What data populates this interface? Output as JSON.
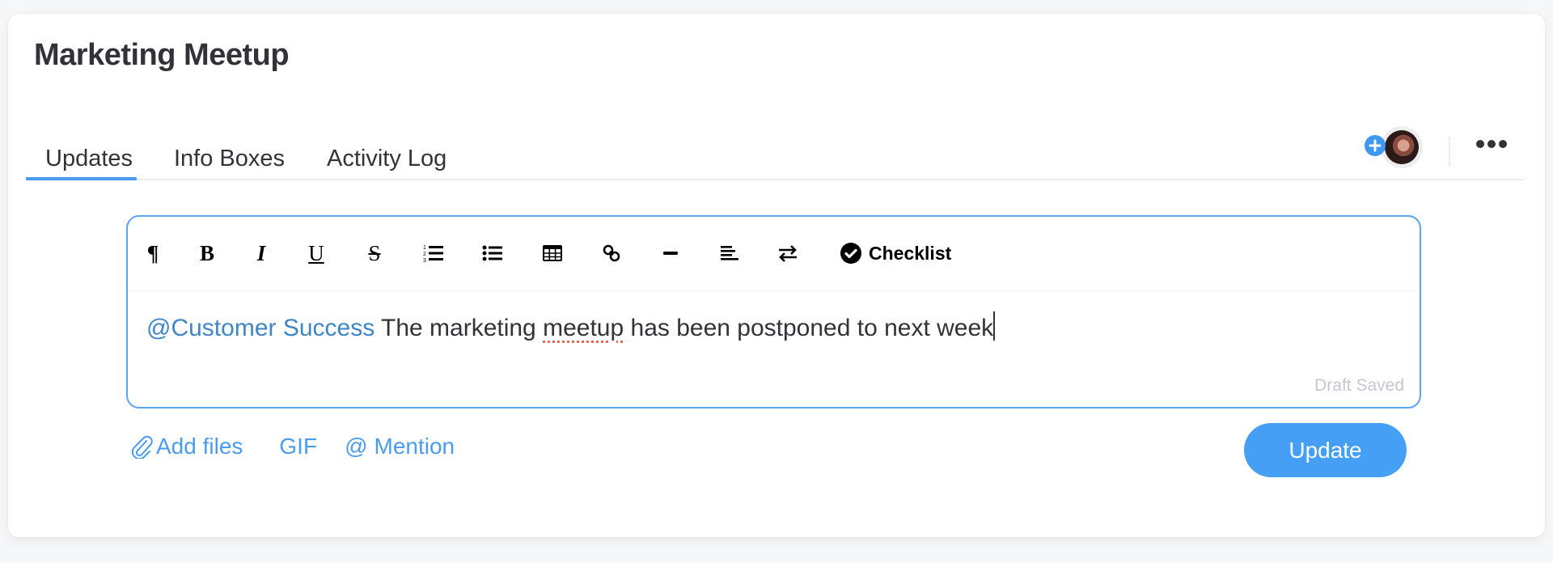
{
  "item": {
    "title": "Marketing Meetup"
  },
  "tabs": [
    {
      "label": "Updates",
      "active": true
    },
    {
      "label": "Info Boxes",
      "active": false
    },
    {
      "label": "Activity Log",
      "active": false
    }
  ],
  "header_actions": {
    "add_subscriber_icon": "plus-circle-icon",
    "avatar_icon": "user-avatar",
    "more_icon": "ellipsis-icon"
  },
  "toolbar": {
    "buttons": [
      {
        "name": "paragraph",
        "glyph": "¶"
      },
      {
        "name": "bold",
        "glyph": "B"
      },
      {
        "name": "italic",
        "glyph": "I"
      },
      {
        "name": "underline",
        "glyph": "U"
      },
      {
        "name": "strikethrough",
        "glyph": "S"
      },
      {
        "name": "numbered-list",
        "glyph": ""
      },
      {
        "name": "bulleted-list",
        "glyph": ""
      },
      {
        "name": "table",
        "glyph": ""
      },
      {
        "name": "link",
        "glyph": ""
      },
      {
        "name": "divider",
        "glyph": ""
      },
      {
        "name": "align",
        "glyph": ""
      },
      {
        "name": "text-direction",
        "glyph": ""
      }
    ],
    "checklist_label": "Checklist"
  },
  "editor": {
    "mention": "@Customer Success",
    "text_before_misspelled": " The marketing ",
    "misspelled_word": "meetup",
    "text_after": " has been postponed to next week",
    "status": "Draft Saved"
  },
  "footer": {
    "add_files_label": "Add files",
    "gif_label": "GIF",
    "mention_symbol": "@",
    "mention_label": "Mention",
    "update_button": "Update"
  },
  "colors": {
    "accent": "#449ff5",
    "mention": "#3f86c9",
    "editor_border": "#5aa4f0",
    "draft_status": "#c5c7d0",
    "spellcheck": "#e86a55"
  }
}
